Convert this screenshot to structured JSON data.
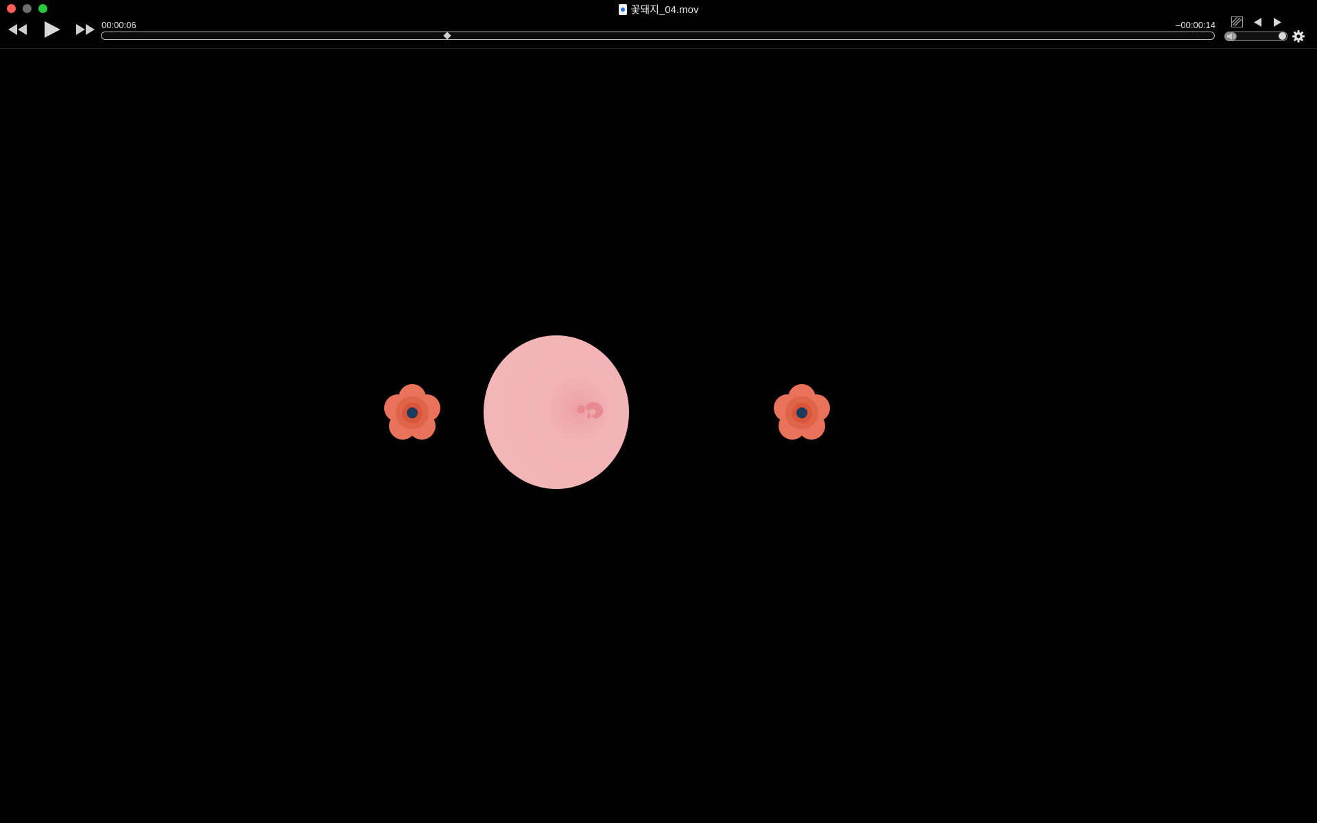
{
  "window": {
    "title": "꽃돼지_04.mov"
  },
  "traffic_lights": {
    "close": "#fe5f57",
    "minimize": "#6d6d6d",
    "zoom": "#28c840"
  },
  "player": {
    "elapsed": "00:00:06",
    "remaining": "–00:00:14",
    "playback_progress": 0.31,
    "volume_level": 0.03
  },
  "icons": {
    "rewind": "rewind-icon",
    "play": "play-icon",
    "fast_forward": "fast-forward-icon",
    "chapter_prev": "step-back-icon",
    "chapter_next": "step-forward-icon",
    "aspect": "aspect-ratio-icon",
    "settings": "gear-icon",
    "volume": "speaker-icon"
  },
  "scene": {
    "background": "#000000",
    "pig_color": "#f1b6b7",
    "flower_color": "#e9735a",
    "flower_center_color": "#1e3a5c"
  }
}
